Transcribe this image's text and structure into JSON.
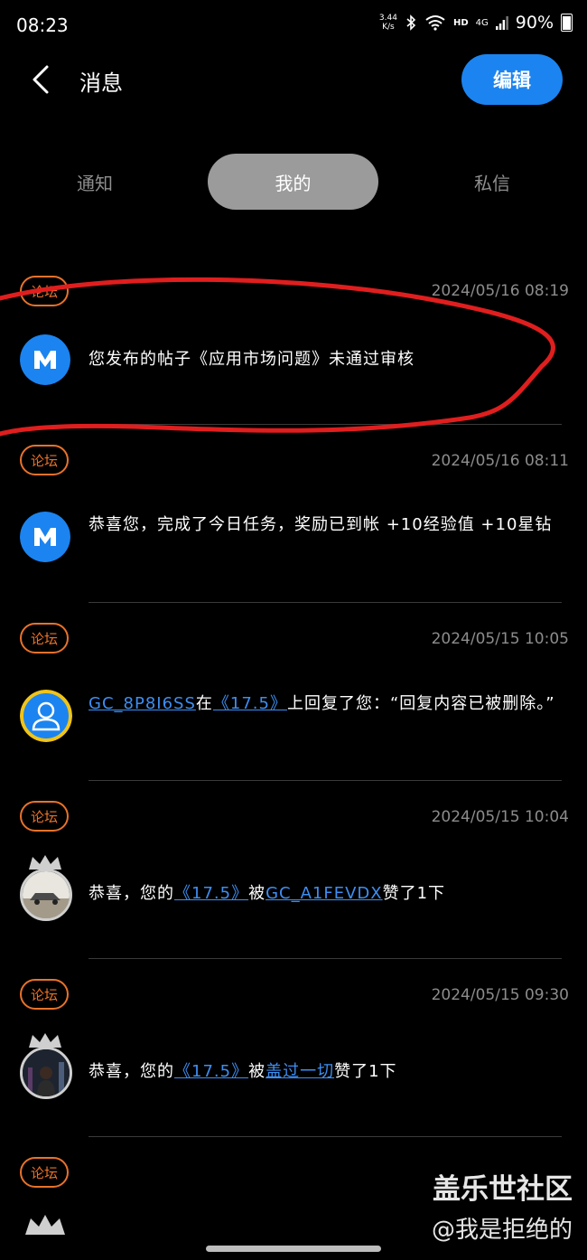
{
  "status_bar": {
    "time": "08:23",
    "net_speed_value": "3.44",
    "net_speed_unit": "K/s",
    "hd": "HD",
    "network": "4G",
    "battery": "90%"
  },
  "header": {
    "title": "消息",
    "edit_label": "编辑"
  },
  "tabs": [
    {
      "label": "通知",
      "active": false
    },
    {
      "label": "我的",
      "active": true
    },
    {
      "label": "私信",
      "active": false
    }
  ],
  "messages": [
    {
      "tag": "论坛",
      "time": "2024/05/16 08:19",
      "avatar": "m-logo-icon",
      "text": "您发布的帖子《应用市场问题》未通过审核"
    },
    {
      "tag": "论坛",
      "time": "2024/05/16 08:11",
      "avatar": "m-logo-icon",
      "text": "恭喜您，完成了今日任务，奖励已到帐 +10经验值 +10星钻"
    },
    {
      "tag": "论坛",
      "time": "2024/05/15 10:05",
      "avatar": "user-default-icon",
      "user": "GC_8P8I6SS",
      "between1": "在",
      "post": "《17.5》",
      "after": "上回复了您：“回复内容已被删除。”"
    },
    {
      "tag": "论坛",
      "time": "2024/05/15 10:04",
      "avatar": "car-photo-avatar",
      "before": "恭喜，您的",
      "post": "《17.5》",
      "between1": "被",
      "user": "GC_A1FEVDX",
      "after": "赞了1下"
    },
    {
      "tag": "论坛",
      "time": "2024/05/15 09:30",
      "avatar": "city-photo-avatar",
      "before": "恭喜，您的",
      "post": "《17.5》",
      "between1": "被",
      "user": "盖过一切",
      "after": "赞了1下"
    },
    {
      "tag": "论坛"
    }
  ],
  "watermark": {
    "line1": "盖乐世社区",
    "line2": "@我是拒绝的"
  },
  "colors": {
    "accent": "#1b84f0",
    "tag": "#e8722a",
    "link": "#3d8ef2",
    "annotation": "#e01e1e"
  }
}
